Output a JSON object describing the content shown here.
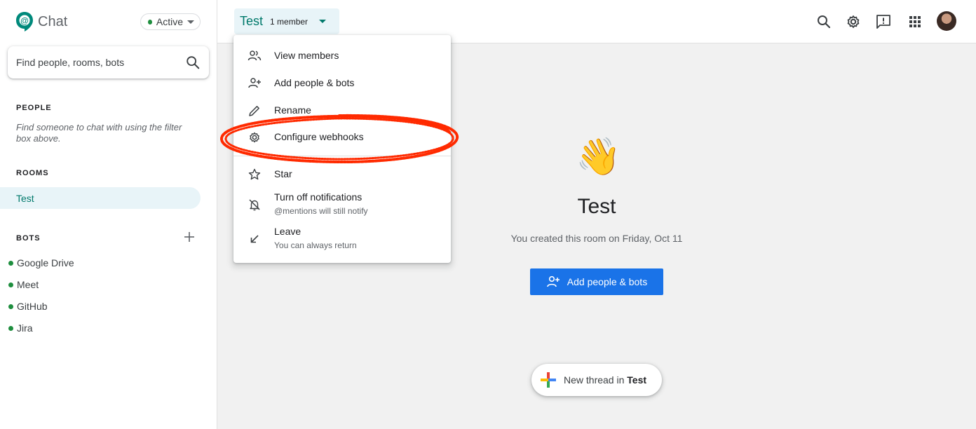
{
  "sidebar": {
    "brand": "Chat",
    "status": "Active",
    "search": {
      "placeholder": "Find people, rooms, bots"
    },
    "people_title": "PEOPLE",
    "people_hint": "Find someone to chat with using the filter box above.",
    "rooms_title": "ROOMS",
    "rooms": [
      "Test"
    ],
    "bots_title": "BOTS",
    "bots": [
      "Google Drive",
      "Meet",
      "GitHub",
      "Jira"
    ]
  },
  "header": {
    "room_name": "Test",
    "members": "1 member"
  },
  "menu": {
    "items": [
      {
        "label": "View members",
        "sub": "",
        "icon": "people-icon"
      },
      {
        "label": "Add people & bots",
        "sub": "",
        "icon": "add-person-icon"
      },
      {
        "label": "Rename",
        "sub": "",
        "icon": "pencil-icon"
      },
      {
        "label": "Configure webhooks",
        "sub": "",
        "icon": "gear-icon"
      },
      {
        "label": "Star",
        "sub": "",
        "icon": "star-icon"
      },
      {
        "label": "Turn off notifications",
        "sub": "@mentions will still notify",
        "icon": "bell-off-icon"
      },
      {
        "label": "Leave",
        "sub": "You can always return",
        "icon": "arrow-down-left-icon"
      }
    ]
  },
  "main": {
    "emoji": "👋",
    "title": "Test",
    "created": "You created this room on Friday, Oct 11",
    "add_button": "Add people & bots",
    "new_thread_prefix": "New thread in",
    "new_thread_room": "Test"
  },
  "colors": {
    "accent_teal": "#00796b",
    "primary_blue": "#1a73e8",
    "status_green": "#1e8e3e",
    "annotation_red": "#ff2a00"
  }
}
